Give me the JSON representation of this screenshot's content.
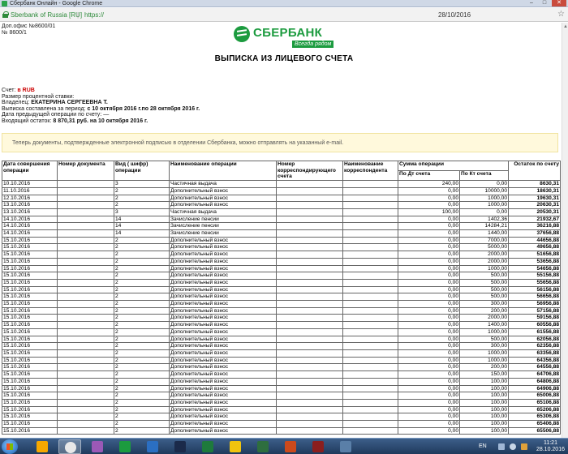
{
  "window": {
    "title": "Сбербанк Онлайн - Google Chrome"
  },
  "address": {
    "site": "Sberbank of Russia [RU]",
    "separator": "|",
    "proto": "https://",
    "date": "28/10/2016"
  },
  "office": {
    "line1": "Доп.офис №8600/01",
    "line2": "№ 8600/1"
  },
  "logo": {
    "brand": "СБЕРБАНК",
    "slogan": "Всегда рядом"
  },
  "doc": {
    "title": "ВЫПИСКА ИЗ ЛИЦЕВОГО СЧЕТА"
  },
  "info": {
    "account_label": "Счет:",
    "account_value": "в RUB",
    "rate_label": "Размер процентной ставки:",
    "owner_label": "Владелец:",
    "owner_value": "ЕКАТЕРИНА СЕРГЕЕВНА Т.",
    "period_label": "Выписка составлена за период:",
    "period_value": "с 10 октября 2016 г.по 28 октября 2016 г.",
    "prev_label": "Дата предыдущей операции по счету:",
    "prev_value": "—",
    "balance_label": "Входящий остаток:",
    "balance_value": "8 870,31 руб. на 10 октября 2016 г."
  },
  "notice": {
    "text": "Теперь документы, подтвержденные электронной подписью в отделении Сбербанка, можно отправлять на указанный e-mail."
  },
  "table": {
    "headers": {
      "date": "Дата совершения операции",
      "docnum": "Номер документа",
      "code": "Вид ( шифр) операции",
      "name": "Наименование операции",
      "corr_acc": "Номер корреспондирующего счета",
      "corr_name": "Наименование корреспондента",
      "sum": "Сумма операции",
      "debit": "По Дт счета",
      "credit": "По Кт счета",
      "balance": "Остаток по счету"
    },
    "rows": [
      [
        "10.10.2016",
        "3",
        "Частичная выдача",
        "240,00",
        "0,00",
        "8630,31"
      ],
      [
        "11.10.2016",
        "2",
        "Дополнительный взнос",
        "0,00",
        "10000,00",
        "18630,31"
      ],
      [
        "12.10.2016",
        "2",
        "Дополнительный взнос",
        "0,00",
        "1000,00",
        "19630,31"
      ],
      [
        "13.10.2016",
        "2",
        "Дополнительный взнос",
        "0,00",
        "1000,00",
        "20630,31"
      ],
      [
        "13.10.2016",
        "3",
        "Частичная выдача",
        "100,00",
        "0,00",
        "20530,31"
      ],
      [
        "14.10.2016",
        "14",
        "Зачисление пенсии",
        "0,00",
        "1402,36",
        "21932,67"
      ],
      [
        "14.10.2016",
        "14",
        "Зачисление пенсии",
        "0,00",
        "14284,21",
        "36216,88"
      ],
      [
        "14.10.2016",
        "14",
        "Зачисление пенсии",
        "0,00",
        "1440,00",
        "37656,88"
      ],
      [
        "15.10.2016",
        "2",
        "Дополнительный взнос",
        "0,00",
        "7000,00",
        "44656,88"
      ],
      [
        "15.10.2016",
        "2",
        "Дополнительный взнос",
        "0,00",
        "5000,00",
        "49656,88"
      ],
      [
        "15.10.2016",
        "2",
        "Дополнительный взнос",
        "0,00",
        "2000,00",
        "51656,88"
      ],
      [
        "15.10.2016",
        "2",
        "Дополнительный взнос",
        "0,00",
        "2000,00",
        "53656,88"
      ],
      [
        "15.10.2016",
        "2",
        "Дополнительный взнос",
        "0,00",
        "1000,00",
        "54656,88"
      ],
      [
        "15.10.2016",
        "2",
        "Дополнительный взнос",
        "0,00",
        "500,00",
        "55156,88"
      ],
      [
        "15.10.2016",
        "2",
        "Дополнительный взнос",
        "0,00",
        "500,00",
        "55656,88"
      ],
      [
        "15.10.2016",
        "2",
        "Дополнительный взнос",
        "0,00",
        "500,00",
        "56156,88"
      ],
      [
        "15.10.2016",
        "2",
        "Дополнительный взнос",
        "0,00",
        "500,00",
        "56656,88"
      ],
      [
        "15.10.2016",
        "2",
        "Дополнительный взнос",
        "0,00",
        "300,00",
        "56956,88"
      ],
      [
        "15.10.2016",
        "2",
        "Дополнительный взнос",
        "0,00",
        "200,00",
        "57156,88"
      ],
      [
        "15.10.2016",
        "2",
        "Дополнительный взнос",
        "0,00",
        "2000,00",
        "59156,88"
      ],
      [
        "15.10.2016",
        "2",
        "Дополнительный взнос",
        "0,00",
        "1400,00",
        "60556,88"
      ],
      [
        "15.10.2016",
        "2",
        "Дополнительный взнос",
        "0,00",
        "1000,00",
        "61556,88"
      ],
      [
        "15.10.2016",
        "2",
        "Дополнительный взнос",
        "0,00",
        "500,00",
        "62056,88"
      ],
      [
        "15.10.2016",
        "2",
        "Дополнительный взнос",
        "0,00",
        "300,00",
        "62356,88"
      ],
      [
        "15.10.2016",
        "2",
        "Дополнительный взнос",
        "0,00",
        "1000,00",
        "63356,88"
      ],
      [
        "15.10.2016",
        "2",
        "Дополнительный взнос",
        "0,00",
        "1000,00",
        "64356,88"
      ],
      [
        "15.10.2016",
        "2",
        "Дополнительный взнос",
        "0,00",
        "200,00",
        "64556,88"
      ],
      [
        "15.10.2016",
        "2",
        "Дополнительный взнос",
        "0,00",
        "150,00",
        "64706,88"
      ],
      [
        "15.10.2016",
        "2",
        "Дополнительный взнос",
        "0,00",
        "100,00",
        "64806,88"
      ],
      [
        "15.10.2016",
        "2",
        "Дополнительный взнос",
        "0,00",
        "100,00",
        "64906,88"
      ],
      [
        "15.10.2016",
        "2",
        "Дополнительный взнос",
        "0,00",
        "100,00",
        "65006,88"
      ],
      [
        "15.10.2016",
        "2",
        "Дополнительный взнос",
        "0,00",
        "100,00",
        "65106,88"
      ],
      [
        "15.10.2016",
        "2",
        "Дополнительный взнос",
        "0,00",
        "100,00",
        "65206,88"
      ],
      [
        "15.10.2016",
        "2",
        "Дополнительный взнос",
        "0,00",
        "100,00",
        "65306,88"
      ],
      [
        "15.10.2016",
        "2",
        "Дополнительный взнос",
        "0,00",
        "100,00",
        "65406,88"
      ],
      [
        "15.10.2016",
        "2",
        "Дополнительный взнос",
        "0,00",
        "100,00",
        "65506,88"
      ]
    ]
  },
  "taskbar": {
    "lang": "EN",
    "time": "11:21",
    "date": "28.10.2016",
    "colors": [
      "#f6a800",
      "#e8e8e8",
      "#9b59b6",
      "#1c9b3f",
      "#2b6fc2",
      "#1b2a4a",
      "#1e7a3c",
      "#f1c40f",
      "#2e6e3e",
      "#cc4a1c",
      "#8b1e1e",
      "#5a7fa8"
    ]
  }
}
